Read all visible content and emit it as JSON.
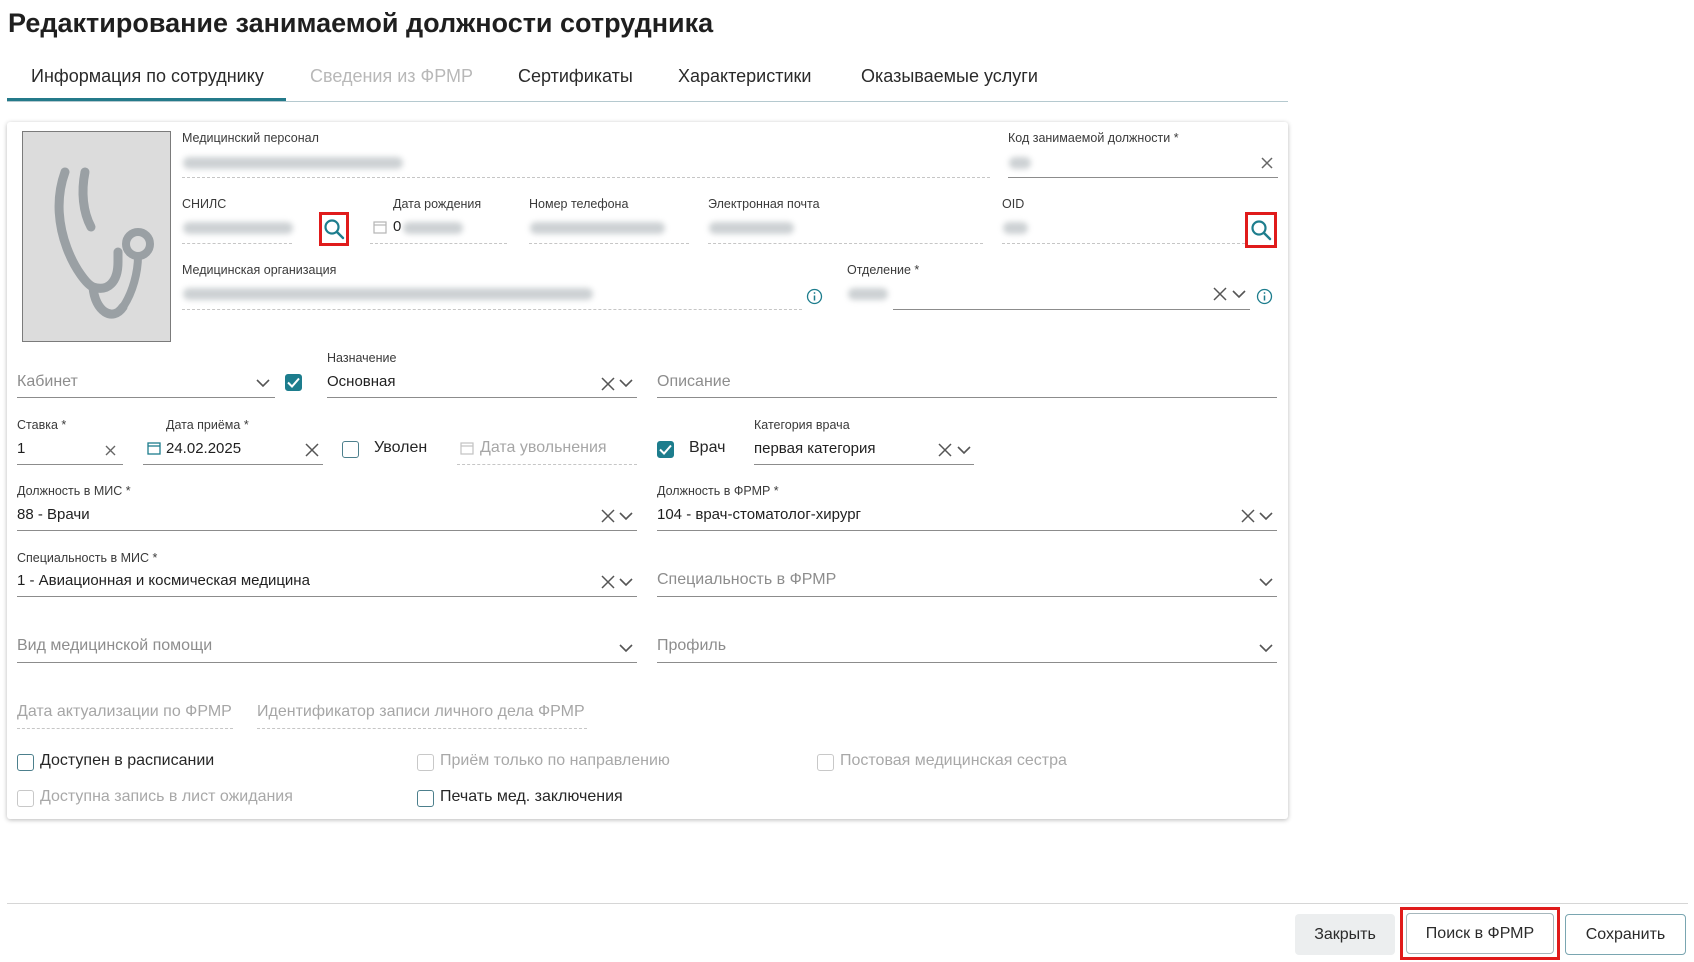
{
  "page": {
    "title": "Редактирование занимаемой должности сотрудника"
  },
  "tabs": [
    {
      "label": "Информация по сотруднику",
      "active": true
    },
    {
      "label": "Сведения из ФРМР",
      "disabled": true
    },
    {
      "label": "Сертификаты"
    },
    {
      "label": "Характеристики"
    },
    {
      "label": "Оказываемые услуги"
    }
  ],
  "fields": {
    "med_staff": {
      "label": "Медицинский персонал"
    },
    "position_code": {
      "label": "Код занимаемой должности *"
    },
    "snils": {
      "label": "СНИЛС"
    },
    "birth_date": {
      "label": "Дата рождения",
      "value_visible": "0"
    },
    "phone": {
      "label": "Номер телефона"
    },
    "email": {
      "label": "Электронная почта"
    },
    "oid": {
      "label": "OID"
    },
    "med_org": {
      "label": "Медицинская организация"
    },
    "department": {
      "label": "Отделение *"
    },
    "cabinet": {
      "placeholder": "Кабинет"
    },
    "purpose": {
      "label": "Назначение",
      "value": "Основная"
    },
    "description": {
      "placeholder": "Описание"
    },
    "rate": {
      "label": "Ставка *",
      "value": "1"
    },
    "hire_date": {
      "label": "Дата приёма *",
      "value": "24.02.2025"
    },
    "dismissed": {
      "label": "Уволен"
    },
    "dismissal_date": {
      "placeholder": "Дата увольнения"
    },
    "doctor": {
      "label": "Врач"
    },
    "doctor_category": {
      "label": "Категория врача",
      "value": "первая категория"
    },
    "mis_position": {
      "label": "Должность в МИС *",
      "value": "88 - Врачи"
    },
    "frmr_position": {
      "label": "Должность в ФРМР *",
      "value": "104 - врач-стоматолог-хирург"
    },
    "mis_specialty": {
      "label": "Специальность в МИС *",
      "value": "1 - Авиационная и космическая медицина"
    },
    "frmr_specialty": {
      "placeholder": "Специальность в ФРМР"
    },
    "care_type": {
      "placeholder": "Вид медицинской помощи"
    },
    "profile": {
      "placeholder": "Профиль"
    },
    "frmr_update_date": {
      "placeholder": "Дата актуализации по ФРМР"
    },
    "frmr_record_id": {
      "placeholder": "Идентификатор записи личного дела ФРМР"
    }
  },
  "checkboxes": {
    "schedule": {
      "label": "Доступен в расписании"
    },
    "referral_only": {
      "label": "Приём только по направлению"
    },
    "post_nurse": {
      "label": "Постовая медицинская сестра"
    },
    "waitlist": {
      "label": "Доступна запись в лист ожидания"
    },
    "print_conclusion": {
      "label": "Печать мед. заключения"
    }
  },
  "buttons": {
    "close": "Закрыть",
    "search_frmr": "Поиск в ФРМР",
    "save": "Сохранить"
  },
  "colors": {
    "accent": "#1d7d8d",
    "highlight": "#e01b1b"
  },
  "icons": [
    "stethoscope-icon",
    "search-icon",
    "calendar-icon",
    "clear-icon",
    "chevron-down-icon",
    "info-icon",
    "checkmark-icon"
  ]
}
